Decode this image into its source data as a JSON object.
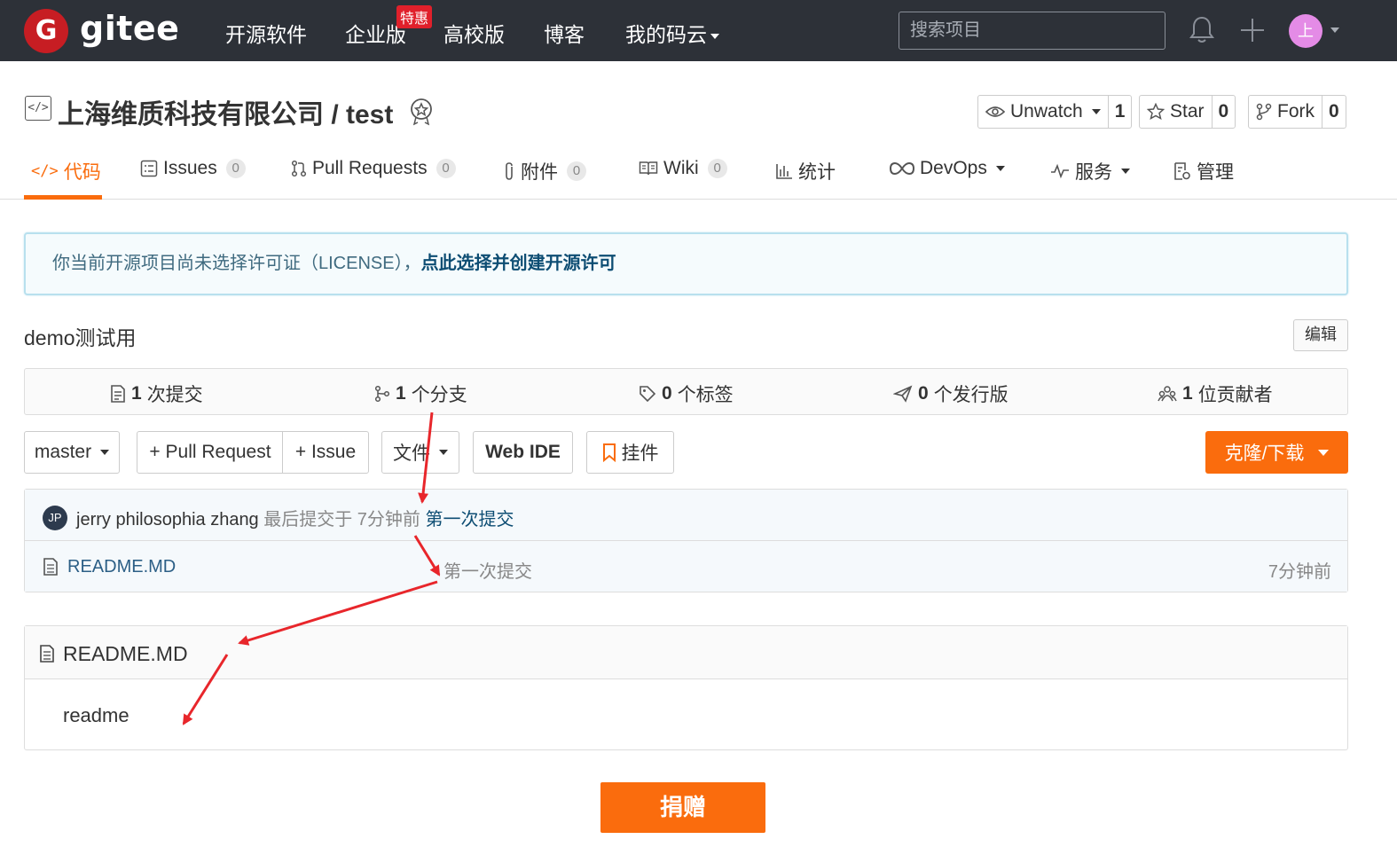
{
  "topnav": {
    "logo_text": "gitee",
    "logo_letter": "G",
    "items": [
      "开源软件",
      "企业版",
      "高校版",
      "博客",
      "我的码云"
    ],
    "enterprise_badge": "特惠",
    "search_placeholder": "搜索项目",
    "avatar_letter": "上",
    "colors": {
      "bg": "#2d3138",
      "logo_red": "#c71d23",
      "avatar": "#e48be6"
    }
  },
  "repo": {
    "title": "上海维质科技有限公司 / test",
    "watch": {
      "label": "Unwatch",
      "count": "1"
    },
    "star": {
      "label": "Star",
      "count": "0"
    },
    "fork": {
      "label": "Fork",
      "count": "0"
    }
  },
  "tabs": [
    {
      "label": "代码",
      "icon": "code-icon"
    },
    {
      "label": "Issues",
      "count": "0",
      "icon": "issues-icon"
    },
    {
      "label": "Pull Requests",
      "count": "0",
      "icon": "pull-request-icon"
    },
    {
      "label": "附件",
      "count": "0",
      "icon": "paperclip-icon"
    },
    {
      "label": "Wiki",
      "count": "0",
      "icon": "book-icon"
    },
    {
      "label": "统计",
      "icon": "bar-chart-icon"
    },
    {
      "label": "DevOps",
      "icon": "infinity-icon"
    },
    {
      "label": "服务",
      "icon": "pulse-icon"
    },
    {
      "label": "管理",
      "icon": "settings-doc-icon"
    }
  ],
  "notice": {
    "text": "你当前开源项目尚未选择许可证（LICENSE），",
    "link": "点此选择并创建开源许可"
  },
  "description": "demo测试用",
  "edit_label": "编辑",
  "stats": [
    {
      "num": "1",
      "label": "次提交",
      "icon": "commit-icon"
    },
    {
      "num": "1",
      "label": "个分支",
      "icon": "branch-icon"
    },
    {
      "num": "0",
      "label": "个标签",
      "icon": "tag-icon"
    },
    {
      "num": "0",
      "label": "个发行版",
      "icon": "release-icon"
    },
    {
      "num": "1",
      "label": "位贡献者",
      "icon": "contributors-icon"
    }
  ],
  "actions": {
    "branch": "master",
    "pull_request": "+ Pull Request",
    "issue": "+ Issue",
    "file": "文件",
    "web_ide": "Web IDE",
    "widget": "挂件",
    "clone": "克隆/下载"
  },
  "commit": {
    "avatar": "JP",
    "author": "jerry philosophia zhang",
    "meta": "最后提交于 7分钟前",
    "message": "第一次提交"
  },
  "files": [
    {
      "name": "README.MD",
      "message": "第一次提交",
      "time": "7分钟前"
    }
  ],
  "readme": {
    "title": "README.MD",
    "body": "readme"
  },
  "donate": "捐赠",
  "colors": {
    "accent": "#fa6c0d",
    "annotation_arrow": "#e8262b"
  }
}
